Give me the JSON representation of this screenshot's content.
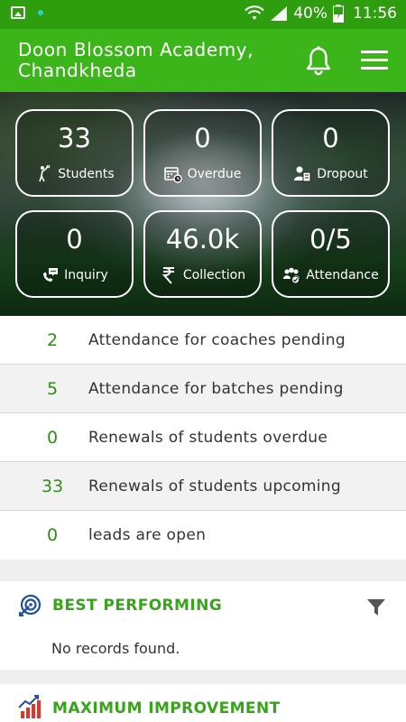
{
  "status_bar": {
    "battery": "40%",
    "time": "11:56"
  },
  "header": {
    "title": "Doon Blossom Academy, Chandkheda",
    "bell_icon": "bell-icon",
    "menu_icon": "hamburger-menu-icon"
  },
  "stats": [
    {
      "value": "33",
      "label": "Students",
      "icon": "badminton-player-icon"
    },
    {
      "value": "0",
      "label": "Overdue",
      "icon": "calendar-clock-icon"
    },
    {
      "value": "0",
      "label": "Dropout",
      "icon": "user-document-icon"
    },
    {
      "value": "0",
      "label": "Inquiry",
      "icon": "phone-chat-icon"
    },
    {
      "value": "46.0k",
      "label": "Collection",
      "icon": "rupee-icon"
    },
    {
      "value": "0/5",
      "label": "Attendance",
      "icon": "group-check-icon"
    }
  ],
  "summary": [
    {
      "count": "2",
      "text": "Attendance for coaches pending"
    },
    {
      "count": "5",
      "text": "Attendance for batches pending"
    },
    {
      "count": "0",
      "text": "Renewals of students overdue"
    },
    {
      "count": "33",
      "text": "Renewals of students upcoming"
    },
    {
      "count": "0",
      "text": "leads are open"
    }
  ],
  "best_performing": {
    "title": "BEST PERFORMING",
    "empty": "No records found.",
    "icon": "target-icon",
    "filter_icon": "filter-icon"
  },
  "maximum_improvement": {
    "title": "MAXIMUM IMPROVEMENT",
    "icon": "growth-chart-icon"
  },
  "colors": {
    "app_bar": "#3bb51a",
    "status_bar": "#2e9e0f",
    "accent_text": "#36a51a",
    "count_text": "#2f8f1a"
  }
}
